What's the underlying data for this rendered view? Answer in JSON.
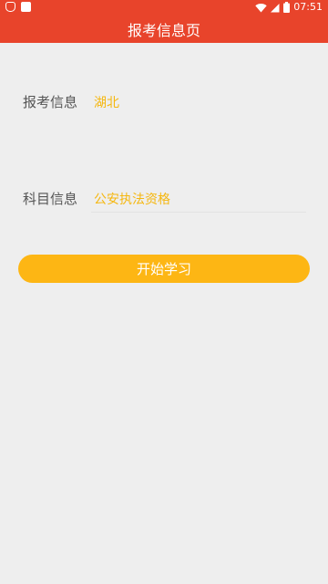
{
  "status_bar": {
    "time": "07:51",
    "icons": [
      "notification-icon",
      "square-notification-icon",
      "wifi-icon",
      "signal-icon",
      "battery-icon"
    ]
  },
  "header": {
    "title": "报考信息页"
  },
  "form": {
    "exam_info": {
      "label": "报考信息",
      "value": "湖北"
    },
    "subject_info": {
      "label": "科目信息",
      "value": "公安执法资格"
    }
  },
  "actions": {
    "start_label": "开始学习"
  },
  "colors": {
    "header_bg": "#e8442b",
    "value_text": "#f5b70f",
    "button_bg": "#fdb614",
    "page_bg": "#eeeeee"
  }
}
